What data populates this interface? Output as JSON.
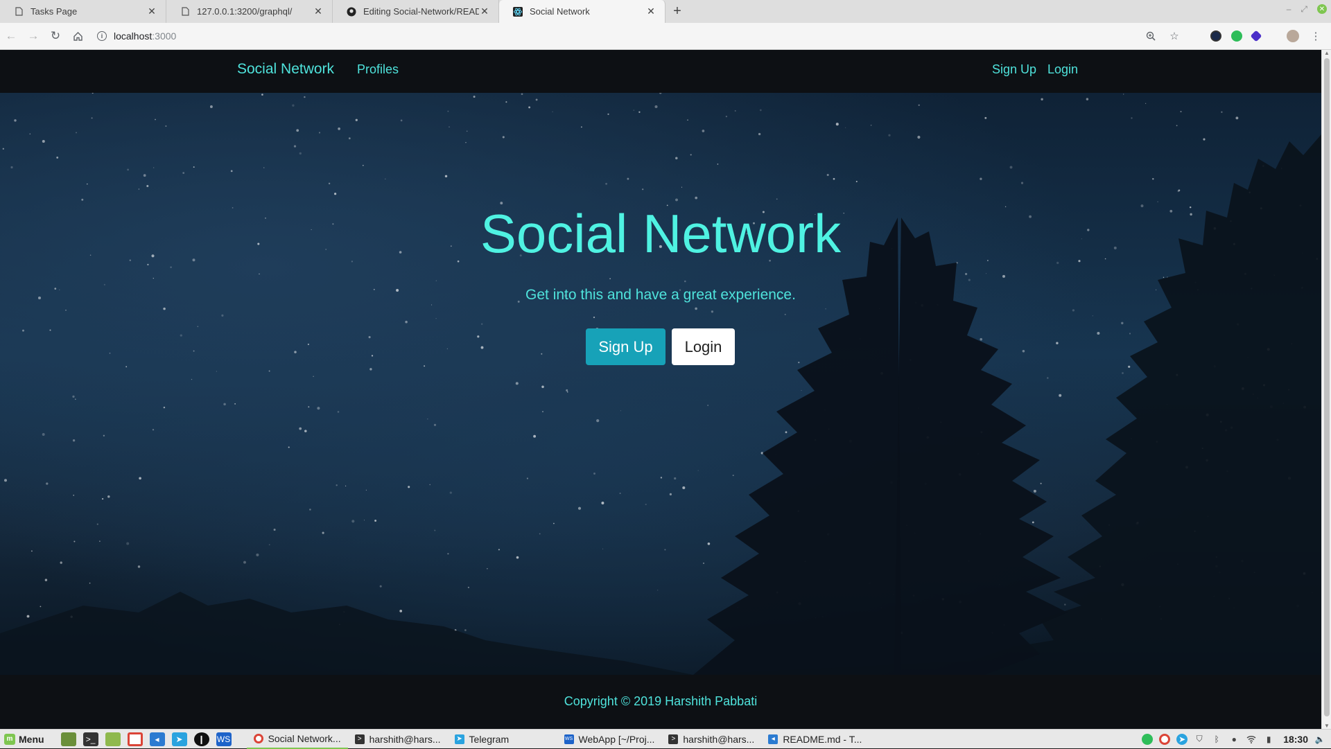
{
  "browser": {
    "tabs": [
      {
        "label": "Tasks Page",
        "icon": "document-icon"
      },
      {
        "label": "127.0.0.1:3200/graphql/",
        "icon": "document-icon"
      },
      {
        "label": "Editing Social-Network/READM",
        "icon": "github-icon"
      },
      {
        "label": "Social Network",
        "icon": "react-icon"
      }
    ],
    "active_tab": 3,
    "address": {
      "host": "localhost",
      "port": ":3000"
    }
  },
  "page": {
    "brand": "Social Network",
    "nav": {
      "profiles": "Profiles",
      "signup": "Sign Up",
      "login": "Login"
    },
    "hero": {
      "title": "Social Network",
      "subtitle": "Get into this and have a great experience.",
      "signup_button": "Sign Up",
      "login_button": "Login"
    },
    "footer": {
      "copyright": "Copyright © 2019 Harshith Pabbati"
    },
    "colors": {
      "accent": "#4fe3dc",
      "button_primary": "#17a2b8",
      "navbar_bg": "#0d1014"
    }
  },
  "taskbar": {
    "menu_label": "Menu",
    "tasks": [
      {
        "label": "Social Network...",
        "icon": "chrome-icon"
      },
      {
        "label": "harshith@hars...",
        "icon": "terminal-icon"
      },
      {
        "label": "Telegram",
        "icon": "telegram-icon"
      },
      {
        "label": "WebApp [~/Proj...",
        "icon": "webstorm-icon"
      },
      {
        "label": "harshith@hars...",
        "icon": "terminal-icon"
      },
      {
        "label": "README.md - T...",
        "icon": "vscode-icon"
      }
    ],
    "clock": "18:30"
  }
}
